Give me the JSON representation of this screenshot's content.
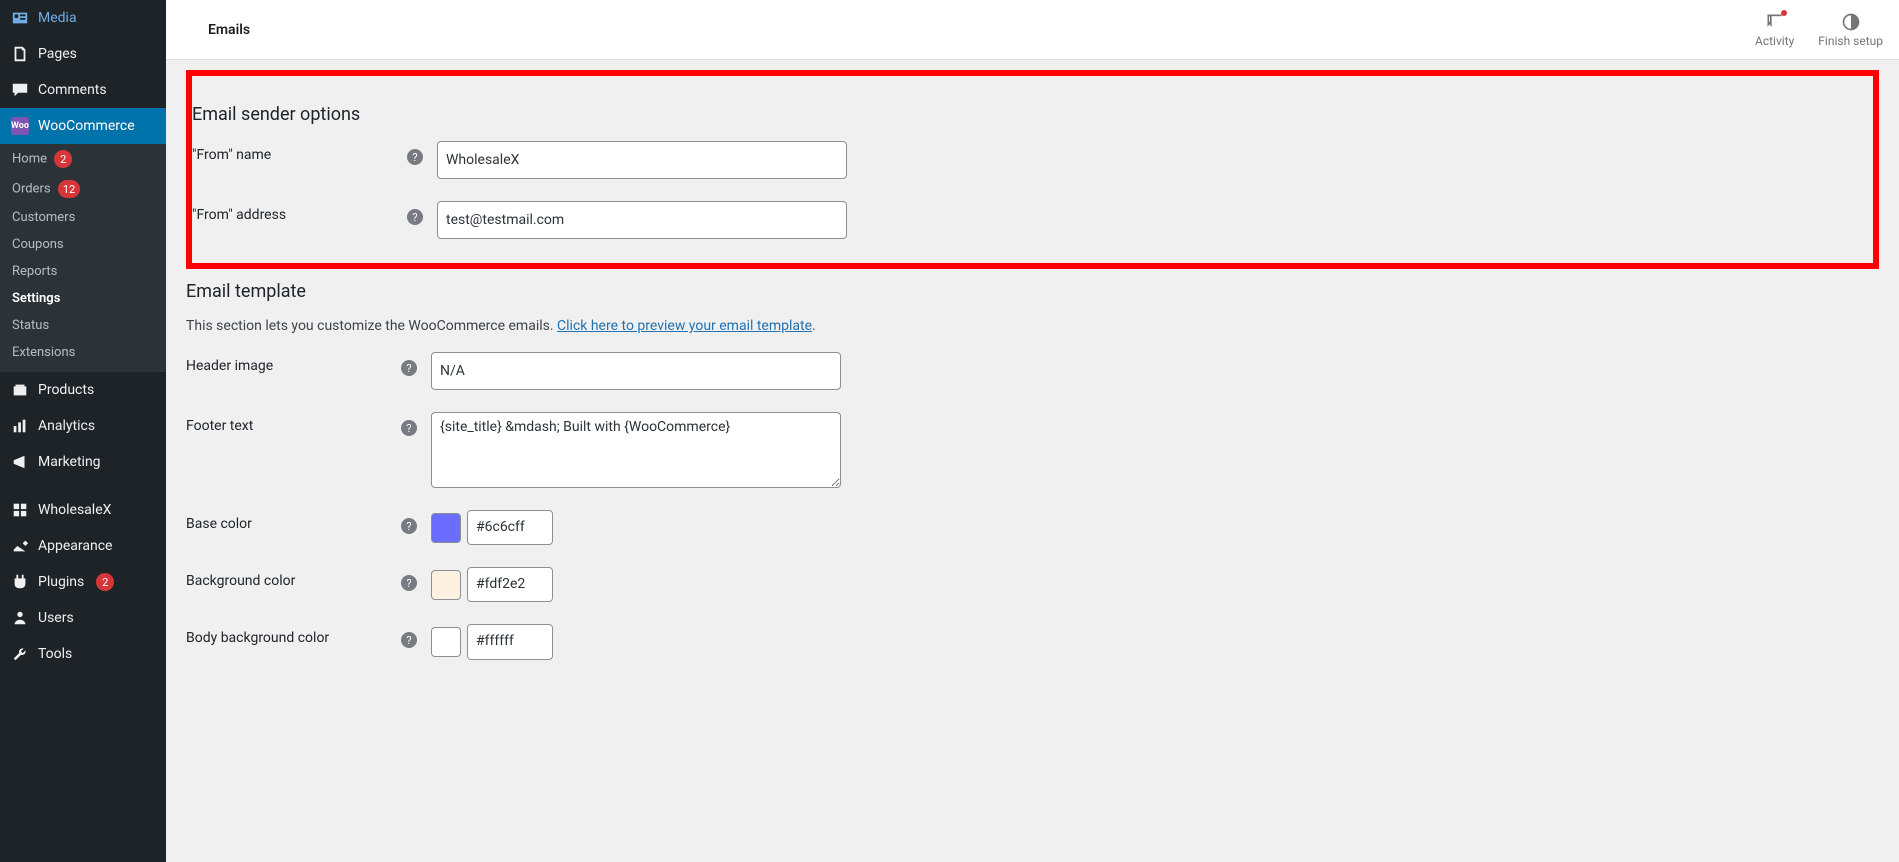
{
  "sidebar": {
    "items": [
      {
        "label": "Media"
      },
      {
        "label": "Pages"
      },
      {
        "label": "Comments"
      },
      {
        "label": "WooCommerce"
      },
      {
        "label": "Products"
      },
      {
        "label": "Analytics"
      },
      {
        "label": "Marketing"
      },
      {
        "label": "WholesaleX"
      },
      {
        "label": "Appearance"
      },
      {
        "label": "Plugins"
      },
      {
        "label": "Users"
      },
      {
        "label": "Tools"
      }
    ],
    "sub": {
      "home": {
        "label": "Home",
        "badge": "2"
      },
      "orders": {
        "label": "Orders",
        "badge": "12"
      },
      "customers": {
        "label": "Customers"
      },
      "coupons": {
        "label": "Coupons"
      },
      "reports": {
        "label": "Reports"
      },
      "settings": {
        "label": "Settings"
      },
      "status": {
        "label": "Status"
      },
      "extensions": {
        "label": "Extensions"
      }
    },
    "plugins_badge": "2"
  },
  "topbar": {
    "tab": "Emails",
    "activity": "Activity",
    "finish": "Finish setup"
  },
  "sender": {
    "heading": "Email sender options",
    "from_name_label": "\"From\" name",
    "from_name_value": "WholesaleX",
    "from_addr_label": "\"From\" address",
    "from_addr_value": "test@testmail.com"
  },
  "template": {
    "heading": "Email template",
    "desc_prefix": "This section lets you customize the WooCommerce emails. ",
    "desc_link": "Click here to preview your email template",
    "desc_suffix": ".",
    "header_image_label": "Header image",
    "header_image_value": "N/A",
    "footer_text_label": "Footer text",
    "footer_text_value": "{site_title} &mdash; Built with {WooCommerce}",
    "base_color_label": "Base color",
    "base_color_value": "#6c6cff",
    "bg_color_label": "Background color",
    "bg_color_value": "#fdf2e2",
    "body_bg_label": "Body background color",
    "body_bg_value": "#ffffff"
  }
}
